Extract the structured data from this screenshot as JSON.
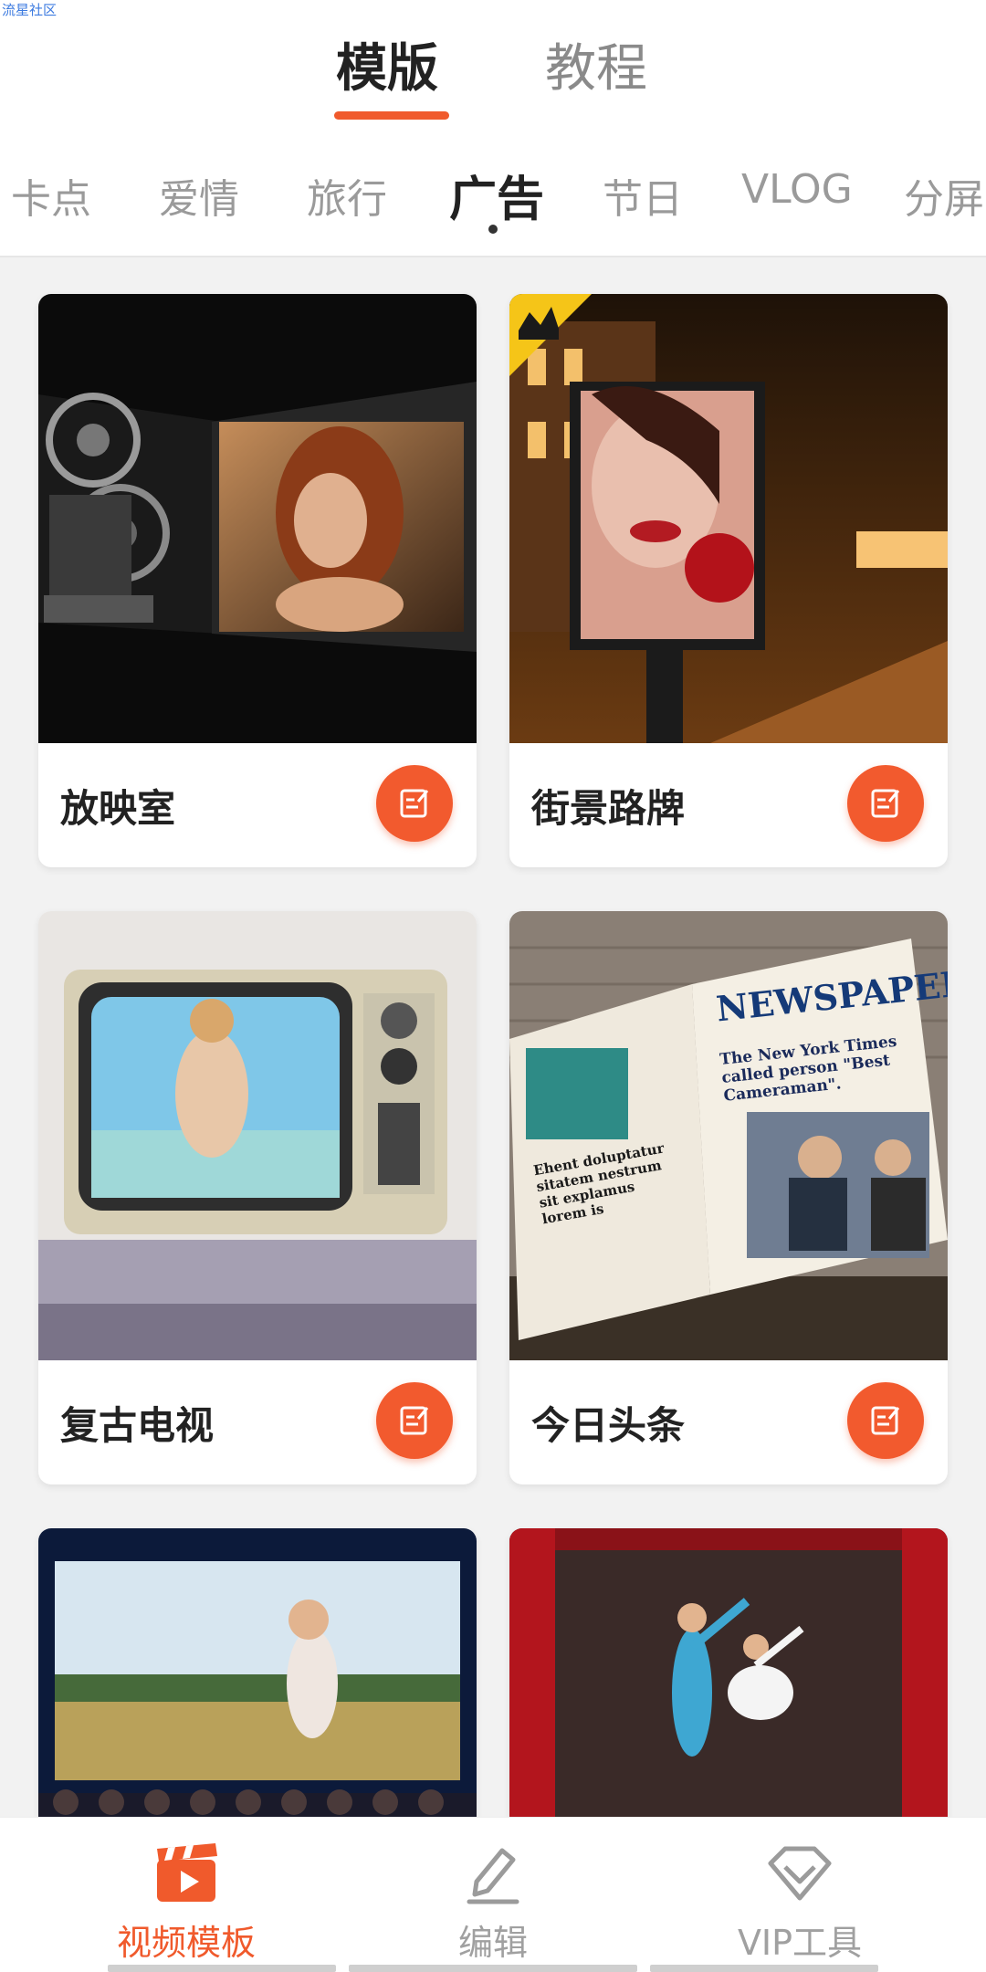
{
  "watermark": "流星社区",
  "main_tabs": [
    {
      "label": "模版",
      "active": true
    },
    {
      "label": "教程",
      "active": false
    }
  ],
  "categories": [
    {
      "label": "卡点",
      "active": false
    },
    {
      "label": "爱情",
      "active": false
    },
    {
      "label": "旅行",
      "active": false
    },
    {
      "label": "广告",
      "active": true
    },
    {
      "label": "节日",
      "active": false
    },
    {
      "label": "VLOG",
      "active": false
    },
    {
      "label": "分屏",
      "active": false
    }
  ],
  "cards": [
    {
      "title": "放映室",
      "icon": "edit-icon",
      "premium": false
    },
    {
      "title": "街景路牌",
      "icon": "edit-icon",
      "premium": true
    },
    {
      "title": "复古电视",
      "icon": "edit-icon",
      "premium": false
    },
    {
      "title": "今日头条",
      "icon": "edit-icon",
      "premium": false
    },
    {
      "title": "",
      "icon": "edit-icon",
      "premium": false
    },
    {
      "title": "",
      "icon": "edit-icon",
      "premium": false
    }
  ],
  "newspaper_texts": {
    "masthead": "NEWSPAPER",
    "headline": "The New York Times called person \"Best Cameraman\".",
    "side": "Ehent doluptatur sitatem nestrum sit explamus lorem is"
  },
  "bottom_nav": [
    {
      "label": "视频模板",
      "icon": "clapperboard-icon",
      "active": true
    },
    {
      "label": "编辑",
      "icon": "pen-icon",
      "active": false
    },
    {
      "label": "VIP工具",
      "icon": "diamond-icon",
      "active": false
    }
  ],
  "colors": {
    "accent": "#f05a2c",
    "inactive": "#a0a0a0"
  }
}
